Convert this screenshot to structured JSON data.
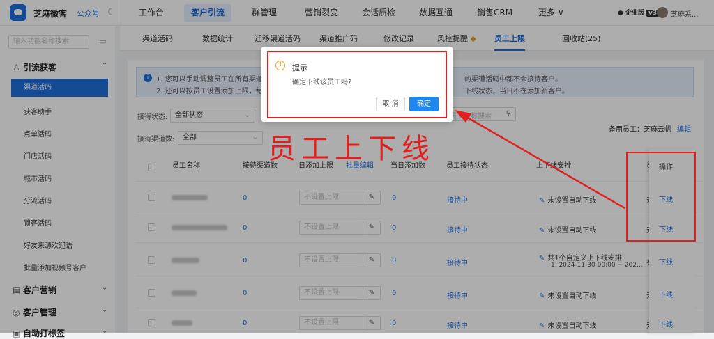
{
  "app": {
    "name": "芝麻微客",
    "public_account": "公众号"
  },
  "topnav": [
    "工作台",
    "客户引流",
    "群管理",
    "营销裂变",
    "会话质检",
    "数据互通",
    "销售CRM",
    "更多 ∨"
  ],
  "account": {
    "edition": "企业版",
    "level": "v3",
    "user": "芝麻系..."
  },
  "sidebar": {
    "search_placeholder": "输入功能名称搜索",
    "group_active": "引流获客",
    "items": [
      "渠道活码",
      "获客助手",
      "点单活码",
      "门店活码",
      "城市活码",
      "分流活码",
      "锁客活码",
      "好友来源欢迎语",
      "批量添加视频号客户"
    ],
    "groups": [
      "客户营销",
      "客户管理",
      "自动打标签"
    ]
  },
  "subtabs": [
    "渠道活码",
    "数据统计",
    "迁移渠道活码",
    "渠道推广码",
    "修改记录",
    "风控提醒",
    "员工上限",
    "回收站(25)"
  ],
  "notice": {
    "line1": "1. 您可以手动调整员工在所有渠道活",
    "line2": "2. 还可以按员工设置添加上限，每日",
    "line1_tail": "的渠道活码中都不会接待客户。",
    "line2_tail": "下线状态，当日不在添加新客户。"
  },
  "filters": {
    "status_label": "接待状态:",
    "status_value": "全部状态",
    "count_label": "接待渠道数:",
    "count_value": "全部",
    "search_placeholder": "员工名称搜索"
  },
  "backup": {
    "label": "备用员工：芝麻云帆",
    "edit": "编辑"
  },
  "table": {
    "headers": [
      "员工名称",
      "接待渠道数",
      "日添加上限",
      "批量编辑",
      "当日添加数",
      "员工接待状态",
      "上下线安排",
      "员",
      "操作"
    ],
    "limit_placeholder": "不设置上限",
    "rows": [
      {
        "channels": "0",
        "today": "0",
        "status": "接待中",
        "schedule": "未设置自动下线",
        "schedule_detail": "",
        "col7": "无",
        "action": "下线"
      },
      {
        "channels": "0",
        "today": "0",
        "status": "接待中",
        "schedule": "未设置自动下线",
        "schedule_detail": "",
        "col7": "无",
        "action": "下线"
      },
      {
        "channels": "0",
        "today": "0",
        "status": "接待中",
        "schedule": "共1个自定义上下线安排",
        "schedule_detail": "1. 2024-11-30 00:00 ~ 202...",
        "col7": "有",
        "action": "下线"
      },
      {
        "channels": "0",
        "today": "0",
        "status": "接待中",
        "schedule": "未设置自动下线",
        "schedule_detail": "",
        "col7": "无",
        "action": "下线"
      },
      {
        "channels": "0",
        "today": "0",
        "status": "接待中",
        "schedule": "未设置自动下线",
        "schedule_detail": "",
        "col7": "无",
        "action": "下线"
      }
    ]
  },
  "dialog": {
    "title": "提示",
    "message": "确定下线该员工吗?",
    "cancel": "取 消",
    "ok": "确定"
  },
  "annotation": {
    "text": "员工上下线",
    "color": "#e02020"
  },
  "colors": {
    "primary": "#1f6fdc",
    "warning": "#f0a020",
    "annotation": "#e02020"
  }
}
